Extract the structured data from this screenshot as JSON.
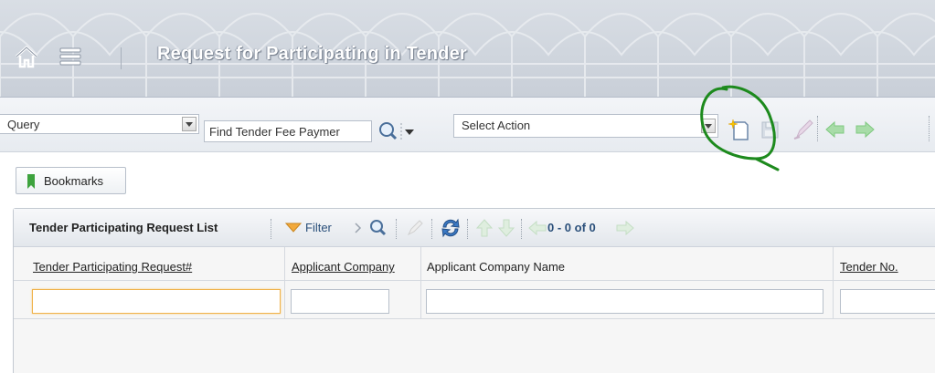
{
  "header": {
    "title": "Request for Participating in Tender",
    "icons": [
      "home-icon",
      "menu-icon"
    ]
  },
  "toolbar": {
    "query_select": {
      "value": "Query"
    },
    "find_input": {
      "value": "Find Tender Fee Paymer"
    },
    "action_select": {
      "value": "Select Action"
    },
    "icons": [
      "search-icon",
      "new-record-icon",
      "save-icon",
      "edit-icon",
      "back-arrow-icon",
      "forward-arrow-icon"
    ]
  },
  "bookmarks": {
    "label": "Bookmarks"
  },
  "list": {
    "title": "Tender Participating Request List",
    "filter_label": "Filter",
    "range_text": "0 - 0 of 0",
    "columns": [
      {
        "label": "Tender Participating Request#"
      },
      {
        "label": "Applicant Company"
      },
      {
        "label": "Applicant Company Name"
      },
      {
        "label": "Tender No."
      }
    ],
    "filter_values": [
      "",
      "",
      "",
      ""
    ]
  },
  "colors": {
    "accent_blue": "#2a4f7a",
    "focus_orange": "#f0b24a",
    "annotation_green": "#1d8a1d",
    "arrow_green": "#7fc97f"
  }
}
